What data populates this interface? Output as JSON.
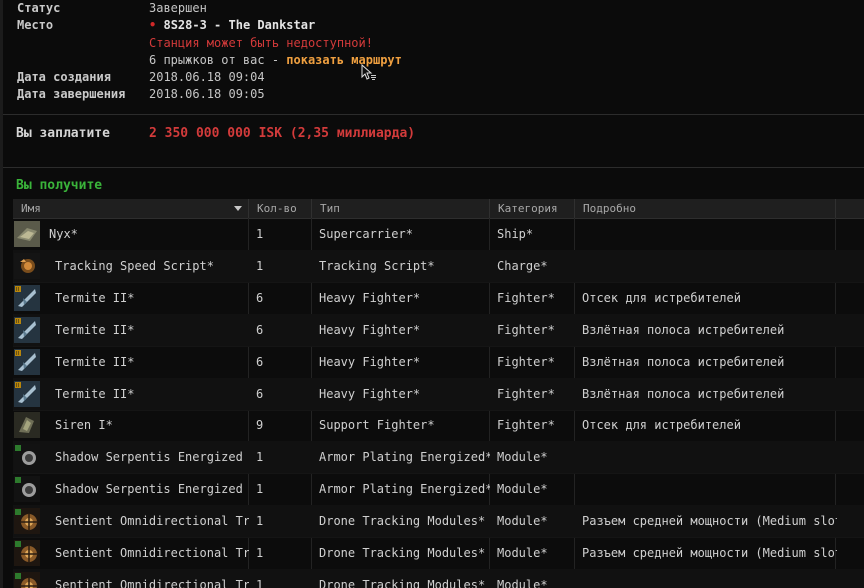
{
  "details": {
    "status_label": "Статус",
    "status_value": "Завершен",
    "location_label": "Место",
    "location_bullet": "•",
    "location_value": "8S28-3 - The Dankstar",
    "location_warning": "Станция может быть недоступной!",
    "jumps_text": "6 прыжков от вас - ",
    "route_link": "показать маршрут",
    "created_label": "Дата создания",
    "created_value": "2018.06.18 09:04",
    "completed_label": "Дата завершения",
    "completed_value": "2018.06.18 09:05"
  },
  "payment": {
    "label": "Вы заплатите",
    "value": "2 350 000 000 ISK (2,35 миллиарда)"
  },
  "receive": {
    "label": "Вы получите"
  },
  "table": {
    "headers": {
      "name": "Имя",
      "qty": "Кол-во",
      "type": "Тип",
      "category": "Категория",
      "details": "Подробно"
    },
    "rows": [
      {
        "icon": "supercarrier-icon",
        "name": "Nyx*",
        "qty": "1",
        "type": "Supercarrier*",
        "category": "Ship*",
        "details": ""
      },
      {
        "icon": "script-icon",
        "name": "Tracking Speed Script*",
        "qty": "1",
        "type": "Tracking Script*",
        "category": "Charge*",
        "details": ""
      },
      {
        "icon": "fighter-icon",
        "name": "Termite II*",
        "qty": "6",
        "type": "Heavy Fighter*",
        "category": "Fighter*",
        "details": "Отсек для истребителей"
      },
      {
        "icon": "fighter-icon",
        "name": "Termite II*",
        "qty": "6",
        "type": "Heavy Fighter*",
        "category": "Fighter*",
        "details": "Взлётная полоса истребителей"
      },
      {
        "icon": "fighter-icon",
        "name": "Termite II*",
        "qty": "6",
        "type": "Heavy Fighter*",
        "category": "Fighter*",
        "details": "Взлётная полоса истребителей"
      },
      {
        "icon": "fighter-icon",
        "name": "Termite II*",
        "qty": "6",
        "type": "Heavy Fighter*",
        "category": "Fighter*",
        "details": "Взлётная полоса истребителей"
      },
      {
        "icon": "support-fighter-icon",
        "name": "Siren I*",
        "qty": "9",
        "type": "Support Fighter*",
        "category": "Fighter*",
        "details": "Отсек для истребителей"
      },
      {
        "icon": "armor-plating-icon",
        "name": "Shadow Serpentis Energized Ad",
        "qty": "1",
        "type": "Armor Plating Energized*",
        "category": "Module*",
        "details": ""
      },
      {
        "icon": "armor-plating-icon",
        "name": "Shadow Serpentis Energized Ad",
        "qty": "1",
        "type": "Armor Plating Energized*",
        "category": "Module*",
        "details": ""
      },
      {
        "icon": "drone-tracking-icon",
        "name": "Sentient Omnidirectional Tracking",
        "qty": "1",
        "type": "Drone Tracking Modules*",
        "category": "Module*",
        "details": "Разъем средней мощности (Medium slot)"
      },
      {
        "icon": "drone-tracking-icon",
        "name": "Sentient Omnidirectional Tracking",
        "qty": "1",
        "type": "Drone Tracking Modules*",
        "category": "Module*",
        "details": "Разъем средней мощности (Medium slot)"
      },
      {
        "icon": "drone-tracking-icon",
        "name": "Sentient Omnidirectional Tracking",
        "qty": "1",
        "type": "Drone Tracking Modules*",
        "category": "Module*",
        "details": ""
      }
    ]
  },
  "colors": {
    "warning": "#d43a3a",
    "link": "#f0a040",
    "price": "#d33b3b",
    "receive": "#3ab43a"
  }
}
